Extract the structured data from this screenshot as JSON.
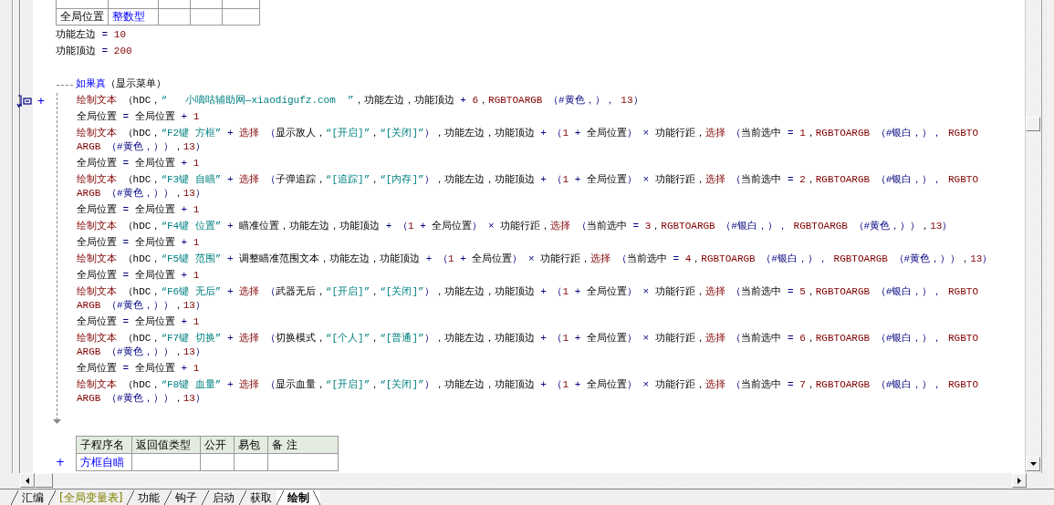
{
  "var_table": {
    "rows": [
      {
        "name": "全局位置",
        "type": "整数型"
      }
    ]
  },
  "statements": [
    {
      "rows": [
        {
          "tokens": [
            {
              "kind": "txt",
              "text": "功能左边 "
            },
            {
              "kind": "op",
              "text": "= "
            },
            {
              "kind": "num",
              "text": "10"
            }
          ]
        }
      ]
    },
    {
      "rows": [
        {
          "tokens": [
            {
              "kind": "txt",
              "text": "功能顶边 "
            },
            {
              "kind": "op",
              "text": "= "
            },
            {
              "kind": "num",
              "text": "200"
            }
          ]
        }
      ]
    }
  ],
  "if_block": {
    "header": {
      "tokens": [
        {
          "kind": "kw",
          "text": "如果真"
        },
        {
          "kind": "txt",
          "text": "（显示菜单）"
        }
      ]
    },
    "children": [
      {
        "bookmark": true,
        "sign": "+",
        "rows": [
          {
            "tokens": [
              {
                "kind": "fn",
                "text": "绘制文本"
              },
              {
                "kind": "txt",
                "text": " （hDC，"
              },
              {
                "kind": "str",
                "text": "“   小嘀咕辅助网—xiaodigufz.com  ”"
              },
              {
                "kind": "txt",
                "text": "，功能左边，功能顶边 "
              },
              {
                "kind": "op",
                "text": "+ "
              },
              {
                "kind": "num",
                "text": "6"
              },
              {
                "kind": "txt",
                "text": "，"
              },
              {
                "kind": "fn",
                "text": "RGBTOARGB"
              },
              {
                "kind": "op",
                "text": " （"
              },
              {
                "kind": "const",
                "text": "#黄色"
              },
              {
                "kind": "op",
                "text": "，），"
              },
              {
                "kind": "num",
                "text": " 13"
              },
              {
                "kind": "op",
                "text": "）"
              }
            ]
          }
        ]
      },
      {
        "rows": [
          {
            "tokens": [
              {
                "kind": "txt",
                "text": "全局位置 "
              },
              {
                "kind": "op",
                "text": "= "
              },
              {
                "kind": "txt",
                "text": "全局位置 "
              },
              {
                "kind": "op",
                "text": "+ "
              },
              {
                "kind": "num",
                "text": "1"
              }
            ]
          }
        ]
      },
      {
        "rows": [
          {
            "tokens": [
              {
                "kind": "fn",
                "text": "绘制文本"
              },
              {
                "kind": "txt",
                "text": " （hDC，"
              },
              {
                "kind": "str",
                "text": "“F2键 方框”"
              },
              {
                "kind": "op",
                "text": " + "
              },
              {
                "kind": "fn",
                "text": "选择"
              },
              {
                "kind": "op",
                "text": " （"
              },
              {
                "kind": "txt",
                "text": "显示敌人，"
              },
              {
                "kind": "str",
                "text": "“[开启]”"
              },
              {
                "kind": "txt",
                "text": "，"
              },
              {
                "kind": "str",
                "text": "“[关闭]”"
              },
              {
                "kind": "op",
                "text": "）"
              },
              {
                "kind": "txt",
                "text": "，功能左边，功能顶边 "
              },
              {
                "kind": "op",
                "text": "+ （"
              },
              {
                "kind": "num",
                "text": "1"
              },
              {
                "kind": "op",
                "text": " + "
              },
              {
                "kind": "txt",
                "text": "全局位置"
              },
              {
                "kind": "op",
                "text": "） × "
              },
              {
                "kind": "txt",
                "text": "功能行距，"
              },
              {
                "kind": "fn",
                "text": "选择"
              },
              {
                "kind": "op",
                "text": " （"
              },
              {
                "kind": "txt",
                "text": "当前选中 "
              },
              {
                "kind": "op",
                "text": "= "
              },
              {
                "kind": "num",
                "text": "1"
              },
              {
                "kind": "txt",
                "text": "，"
              },
              {
                "kind": "fn",
                "text": "RGBTOARGB"
              },
              {
                "kind": "op",
                "text": " （"
              },
              {
                "kind": "const",
                "text": "#银白"
              },
              {
                "kind": "op",
                "text": "，），"
              },
              {
                "kind": "fn",
                "text": " RGBTO"
              }
            ]
          },
          {
            "tokens": [
              {
                "kind": "fn",
                "text": "ARGB"
              },
              {
                "kind": "op",
                "text": " （"
              },
              {
                "kind": "const",
                "text": "#黄色"
              },
              {
                "kind": "op",
                "text": "，））"
              },
              {
                "kind": "txt",
                "text": "，"
              },
              {
                "kind": "num",
                "text": "13"
              },
              {
                "kind": "op",
                "text": "）"
              }
            ]
          }
        ]
      },
      {
        "rows": [
          {
            "tokens": [
              {
                "kind": "txt",
                "text": "全局位置 "
              },
              {
                "kind": "op",
                "text": "= "
              },
              {
                "kind": "txt",
                "text": "全局位置 "
              },
              {
                "kind": "op",
                "text": "+ "
              },
              {
                "kind": "num",
                "text": "1"
              }
            ]
          }
        ]
      },
      {
        "rows": [
          {
            "tokens": [
              {
                "kind": "fn",
                "text": "绘制文本"
              },
              {
                "kind": "txt",
                "text": " （hDC，"
              },
              {
                "kind": "str",
                "text": "“F3键 自瞄”"
              },
              {
                "kind": "op",
                "text": " + "
              },
              {
                "kind": "fn",
                "text": "选择"
              },
              {
                "kind": "op",
                "text": " （"
              },
              {
                "kind": "txt",
                "text": "子弹追踪，"
              },
              {
                "kind": "str",
                "text": "“[追踪]”"
              },
              {
                "kind": "txt",
                "text": "，"
              },
              {
                "kind": "str",
                "text": "“[内存]”"
              },
              {
                "kind": "op",
                "text": "）"
              },
              {
                "kind": "txt",
                "text": "，功能左边，功能顶边 "
              },
              {
                "kind": "op",
                "text": "+ （"
              },
              {
                "kind": "num",
                "text": "1"
              },
              {
                "kind": "op",
                "text": " + "
              },
              {
                "kind": "txt",
                "text": "全局位置"
              },
              {
                "kind": "op",
                "text": "） × "
              },
              {
                "kind": "txt",
                "text": "功能行距，"
              },
              {
                "kind": "fn",
                "text": "选择"
              },
              {
                "kind": "op",
                "text": " （"
              },
              {
                "kind": "txt",
                "text": "当前选中 "
              },
              {
                "kind": "op",
                "text": "= "
              },
              {
                "kind": "num",
                "text": "2"
              },
              {
                "kind": "txt",
                "text": "，"
              },
              {
                "kind": "fn",
                "text": "RGBTOARGB"
              },
              {
                "kind": "op",
                "text": " （"
              },
              {
                "kind": "const",
                "text": "#银白"
              },
              {
                "kind": "op",
                "text": "，），"
              },
              {
                "kind": "fn",
                "text": " RGBTO"
              }
            ]
          },
          {
            "tokens": [
              {
                "kind": "fn",
                "text": "ARGB"
              },
              {
                "kind": "op",
                "text": " （"
              },
              {
                "kind": "const",
                "text": "#黄色"
              },
              {
                "kind": "op",
                "text": "，））"
              },
              {
                "kind": "txt",
                "text": "，"
              },
              {
                "kind": "num",
                "text": "13"
              },
              {
                "kind": "op",
                "text": "）"
              }
            ]
          }
        ]
      },
      {
        "rows": [
          {
            "tokens": [
              {
                "kind": "txt",
                "text": "全局位置 "
              },
              {
                "kind": "op",
                "text": "= "
              },
              {
                "kind": "txt",
                "text": "全局位置 "
              },
              {
                "kind": "op",
                "text": "+ "
              },
              {
                "kind": "num",
                "text": "1"
              }
            ]
          }
        ]
      },
      {
        "rows": [
          {
            "tokens": [
              {
                "kind": "fn",
                "text": "绘制文本"
              },
              {
                "kind": "txt",
                "text": " （hDC，"
              },
              {
                "kind": "str",
                "text": "“F4键 位置”"
              },
              {
                "kind": "op",
                "text": " + "
              },
              {
                "kind": "txt",
                "text": "瞄准位置，功能左边，功能顶边 "
              },
              {
                "kind": "op",
                "text": "+ （"
              },
              {
                "kind": "num",
                "text": "1"
              },
              {
                "kind": "op",
                "text": " + "
              },
              {
                "kind": "txt",
                "text": "全局位置"
              },
              {
                "kind": "op",
                "text": "） × "
              },
              {
                "kind": "txt",
                "text": "功能行距，"
              },
              {
                "kind": "fn",
                "text": "选择"
              },
              {
                "kind": "op",
                "text": " （"
              },
              {
                "kind": "txt",
                "text": "当前选中 "
              },
              {
                "kind": "op",
                "text": "= "
              },
              {
                "kind": "num",
                "text": "3"
              },
              {
                "kind": "txt",
                "text": "，"
              },
              {
                "kind": "fn",
                "text": "RGBTOARGB"
              },
              {
                "kind": "op",
                "text": " （"
              },
              {
                "kind": "const",
                "text": "#银白"
              },
              {
                "kind": "op",
                "text": "，），"
              },
              {
                "kind": "fn",
                "text": " RGBTOARGB"
              },
              {
                "kind": "op",
                "text": " （"
              },
              {
                "kind": "const",
                "text": "#黄色"
              },
              {
                "kind": "op",
                "text": "，））"
              },
              {
                "kind": "txt",
                "text": "，"
              },
              {
                "kind": "num",
                "text": "13"
              },
              {
                "kind": "op",
                "text": "）"
              }
            ]
          }
        ]
      },
      {
        "rows": [
          {
            "tokens": [
              {
                "kind": "txt",
                "text": "全局位置 "
              },
              {
                "kind": "op",
                "text": "= "
              },
              {
                "kind": "txt",
                "text": "全局位置 "
              },
              {
                "kind": "op",
                "text": "+ "
              },
              {
                "kind": "num",
                "text": "1"
              }
            ]
          }
        ]
      },
      {
        "rows": [
          {
            "tokens": [
              {
                "kind": "fn",
                "text": "绘制文本"
              },
              {
                "kind": "txt",
                "text": " （hDC，"
              },
              {
                "kind": "str",
                "text": "“F5键 范围”"
              },
              {
                "kind": "op",
                "text": " + "
              },
              {
                "kind": "txt",
                "text": "调整瞄准范围文本，功能左边，功能顶边 "
              },
              {
                "kind": "op",
                "text": "+ （"
              },
              {
                "kind": "num",
                "text": "1"
              },
              {
                "kind": "op",
                "text": " + "
              },
              {
                "kind": "txt",
                "text": "全局位置"
              },
              {
                "kind": "op",
                "text": "） × "
              },
              {
                "kind": "txt",
                "text": "功能行距，"
              },
              {
                "kind": "fn",
                "text": "选择"
              },
              {
                "kind": "op",
                "text": " （"
              },
              {
                "kind": "txt",
                "text": "当前选中 "
              },
              {
                "kind": "op",
                "text": "= "
              },
              {
                "kind": "num",
                "text": "4"
              },
              {
                "kind": "txt",
                "text": "，"
              },
              {
                "kind": "fn",
                "text": "RGBTOARGB"
              },
              {
                "kind": "op",
                "text": " （"
              },
              {
                "kind": "const",
                "text": "#银白"
              },
              {
                "kind": "op",
                "text": "，），"
              },
              {
                "kind": "fn",
                "text": " RGBTOARGB"
              },
              {
                "kind": "op",
                "text": " （"
              },
              {
                "kind": "const",
                "text": "#黄色"
              },
              {
                "kind": "op",
                "text": "，））"
              },
              {
                "kind": "txt",
                "text": "，"
              },
              {
                "kind": "num",
                "text": "13"
              },
              {
                "kind": "op",
                "text": "）"
              }
            ]
          }
        ]
      },
      {
        "rows": [
          {
            "tokens": [
              {
                "kind": "txt",
                "text": "全局位置 "
              },
              {
                "kind": "op",
                "text": "= "
              },
              {
                "kind": "txt",
                "text": "全局位置 "
              },
              {
                "kind": "op",
                "text": "+ "
              },
              {
                "kind": "num",
                "text": "1"
              }
            ]
          }
        ]
      },
      {
        "rows": [
          {
            "tokens": [
              {
                "kind": "fn",
                "text": "绘制文本"
              },
              {
                "kind": "txt",
                "text": " （hDC，"
              },
              {
                "kind": "str",
                "text": "“F6键 无后”"
              },
              {
                "kind": "op",
                "text": " + "
              },
              {
                "kind": "fn",
                "text": "选择"
              },
              {
                "kind": "op",
                "text": " （"
              },
              {
                "kind": "txt",
                "text": "武器无后，"
              },
              {
                "kind": "str",
                "text": "“[开启]”"
              },
              {
                "kind": "txt",
                "text": "，"
              },
              {
                "kind": "str",
                "text": "“[关闭]”"
              },
              {
                "kind": "op",
                "text": "）"
              },
              {
                "kind": "txt",
                "text": "，功能左边，功能顶边 "
              },
              {
                "kind": "op",
                "text": "+ （"
              },
              {
                "kind": "num",
                "text": "1"
              },
              {
                "kind": "op",
                "text": " + "
              },
              {
                "kind": "txt",
                "text": "全局位置"
              },
              {
                "kind": "op",
                "text": "） × "
              },
              {
                "kind": "txt",
                "text": "功能行距，"
              },
              {
                "kind": "fn",
                "text": "选择"
              },
              {
                "kind": "op",
                "text": " （"
              },
              {
                "kind": "txt",
                "text": "当前选中 "
              },
              {
                "kind": "op",
                "text": "= "
              },
              {
                "kind": "num",
                "text": "5"
              },
              {
                "kind": "txt",
                "text": "，"
              },
              {
                "kind": "fn",
                "text": "RGBTOARGB"
              },
              {
                "kind": "op",
                "text": " （"
              },
              {
                "kind": "const",
                "text": "#银白"
              },
              {
                "kind": "op",
                "text": "，），"
              },
              {
                "kind": "fn",
                "text": " RGBTO"
              }
            ]
          },
          {
            "tokens": [
              {
                "kind": "fn",
                "text": "ARGB"
              },
              {
                "kind": "op",
                "text": " （"
              },
              {
                "kind": "const",
                "text": "#黄色"
              },
              {
                "kind": "op",
                "text": "，））"
              },
              {
                "kind": "txt",
                "text": "，"
              },
              {
                "kind": "num",
                "text": "13"
              },
              {
                "kind": "op",
                "text": "）"
              }
            ]
          }
        ]
      },
      {
        "rows": [
          {
            "tokens": [
              {
                "kind": "txt",
                "text": "全局位置 "
              },
              {
                "kind": "op",
                "text": "= "
              },
              {
                "kind": "txt",
                "text": "全局位置 "
              },
              {
                "kind": "op",
                "text": "+ "
              },
              {
                "kind": "num",
                "text": "1"
              }
            ]
          }
        ]
      },
      {
        "rows": [
          {
            "tokens": [
              {
                "kind": "fn",
                "text": "绘制文本"
              },
              {
                "kind": "txt",
                "text": " （hDC，"
              },
              {
                "kind": "str",
                "text": "“F7键 切换”"
              },
              {
                "kind": "op",
                "text": " + "
              },
              {
                "kind": "fn",
                "text": "选择"
              },
              {
                "kind": "op",
                "text": " （"
              },
              {
                "kind": "txt",
                "text": "切换模式，"
              },
              {
                "kind": "str",
                "text": "“[个人]”"
              },
              {
                "kind": "txt",
                "text": "，"
              },
              {
                "kind": "str",
                "text": "“[普通]”"
              },
              {
                "kind": "op",
                "text": "）"
              },
              {
                "kind": "txt",
                "text": "，功能左边，功能顶边 "
              },
              {
                "kind": "op",
                "text": "+ （"
              },
              {
                "kind": "num",
                "text": "1"
              },
              {
                "kind": "op",
                "text": " + "
              },
              {
                "kind": "txt",
                "text": "全局位置"
              },
              {
                "kind": "op",
                "text": "） × "
              },
              {
                "kind": "txt",
                "text": "功能行距，"
              },
              {
                "kind": "fn",
                "text": "选择"
              },
              {
                "kind": "op",
                "text": " （"
              },
              {
                "kind": "txt",
                "text": "当前选中 "
              },
              {
                "kind": "op",
                "text": "= "
              },
              {
                "kind": "num",
                "text": "6"
              },
              {
                "kind": "txt",
                "text": "，"
              },
              {
                "kind": "fn",
                "text": "RGBTOARGB"
              },
              {
                "kind": "op",
                "text": " （"
              },
              {
                "kind": "const",
                "text": "#银白"
              },
              {
                "kind": "op",
                "text": "，），"
              },
              {
                "kind": "fn",
                "text": " RGBTO"
              }
            ]
          },
          {
            "tokens": [
              {
                "kind": "fn",
                "text": "ARGB"
              },
              {
                "kind": "op",
                "text": " （"
              },
              {
                "kind": "const",
                "text": "#黄色"
              },
              {
                "kind": "op",
                "text": "，））"
              },
              {
                "kind": "txt",
                "text": "，"
              },
              {
                "kind": "num",
                "text": "13"
              },
              {
                "kind": "op",
                "text": "）"
              }
            ]
          }
        ]
      },
      {
        "rows": [
          {
            "tokens": [
              {
                "kind": "txt",
                "text": "全局位置 "
              },
              {
                "kind": "op",
                "text": "= "
              },
              {
                "kind": "txt",
                "text": "全局位置 "
              },
              {
                "kind": "op",
                "text": "+ "
              },
              {
                "kind": "num",
                "text": "1"
              }
            ]
          }
        ]
      },
      {
        "rows": [
          {
            "tokens": [
              {
                "kind": "fn",
                "text": "绘制文本"
              },
              {
                "kind": "txt",
                "text": " （hDC，"
              },
              {
                "kind": "str",
                "text": "“F8键 血量”"
              },
              {
                "kind": "op",
                "text": " + "
              },
              {
                "kind": "fn",
                "text": "选择"
              },
              {
                "kind": "op",
                "text": " （"
              },
              {
                "kind": "txt",
                "text": "显示血量，"
              },
              {
                "kind": "str",
                "text": "“[开启]”"
              },
              {
                "kind": "txt",
                "text": "，"
              },
              {
                "kind": "str",
                "text": "“[关闭]”"
              },
              {
                "kind": "op",
                "text": "）"
              },
              {
                "kind": "txt",
                "text": "，功能左边，功能顶边 "
              },
              {
                "kind": "op",
                "text": "+ （"
              },
              {
                "kind": "num",
                "text": "1"
              },
              {
                "kind": "op",
                "text": " + "
              },
              {
                "kind": "txt",
                "text": "全局位置"
              },
              {
                "kind": "op",
                "text": "） × "
              },
              {
                "kind": "txt",
                "text": "功能行距，"
              },
              {
                "kind": "fn",
                "text": "选择"
              },
              {
                "kind": "op",
                "text": " （"
              },
              {
                "kind": "txt",
                "text": "当前选中 "
              },
              {
                "kind": "op",
                "text": "= "
              },
              {
                "kind": "num",
                "text": "7"
              },
              {
                "kind": "txt",
                "text": "，"
              },
              {
                "kind": "fn",
                "text": "RGBTOARGB"
              },
              {
                "kind": "op",
                "text": " （"
              },
              {
                "kind": "const",
                "text": "#银白"
              },
              {
                "kind": "op",
                "text": "，），"
              },
              {
                "kind": "fn",
                "text": " RGBTO"
              }
            ]
          },
          {
            "tokens": [
              {
                "kind": "fn",
                "text": "ARGB"
              },
              {
                "kind": "op",
                "text": " （"
              },
              {
                "kind": "const",
                "text": "#黄色"
              },
              {
                "kind": "op",
                "text": "，））"
              },
              {
                "kind": "txt",
                "text": "，"
              },
              {
                "kind": "num",
                "text": "13"
              },
              {
                "kind": "op",
                "text": "）"
              }
            ]
          }
        ]
      }
    ]
  },
  "sub_table": {
    "columns": [
      "子程序名",
      "返回值类型",
      "公开",
      "易包",
      "备 注"
    ],
    "rows": [
      {
        "sign": "+",
        "name": "方框自瞄"
      }
    ]
  },
  "tabs": [
    {
      "label": "汇编",
      "kind": "program",
      "selected": false
    },
    {
      "label": "[全局变量表]",
      "kind": "table",
      "selected": false
    },
    {
      "label": "功能",
      "kind": "program",
      "selected": false
    },
    {
      "label": "钩子",
      "kind": "program",
      "selected": false
    },
    {
      "label": "启动",
      "kind": "program",
      "selected": false
    },
    {
      "label": "获取",
      "kind": "program",
      "selected": false
    },
    {
      "label": "绘制",
      "kind": "program",
      "selected": true
    }
  ]
}
